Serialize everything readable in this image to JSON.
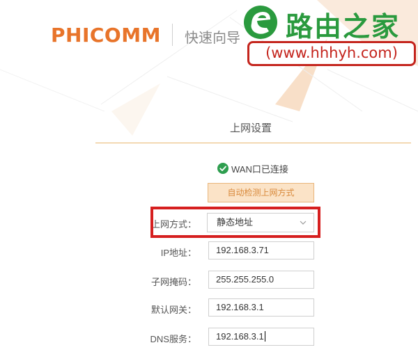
{
  "header": {
    "brand": "PHICOMM",
    "wizard_title": "快速向导"
  },
  "watermark": {
    "title": "路由之家",
    "url": "(www.hhhyh.com)",
    "icon": "e-leaf-logo-icon"
  },
  "section": {
    "title": "上网设置"
  },
  "wan_status": {
    "icon": "check-circle-icon",
    "text": "WAN口已连接"
  },
  "detect_button": {
    "label": "自动检测上网方式"
  },
  "form": {
    "connection_type": {
      "label": "上网方式：",
      "value": "静态地址"
    },
    "ip_address": {
      "label": "IP地址：",
      "value": "192.168.3.71"
    },
    "subnet_mask": {
      "label": "子网掩码：",
      "value": "255.255.255.0"
    },
    "gateway": {
      "label": "默认网关：",
      "value": "192.168.3.1"
    },
    "dns": {
      "label": "DNS服务：",
      "value": "192.168.3.1"
    }
  },
  "colors": {
    "brand": "#e8742a",
    "accent_line": "#e8b56c",
    "button_bg": "#fbe3c7",
    "highlight": "#d61f1f",
    "watermark_green": "#2a9a3e",
    "watermark_red": "#c4241c"
  }
}
